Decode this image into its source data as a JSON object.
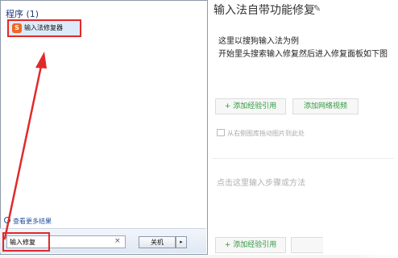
{
  "editor": {
    "title": "输入法自带功能修复",
    "edit_icon": "pencil-icon",
    "step1_lines": [
      "这里以搜狗输入法为例",
      "开始里头搜索输入修复然后进入修复面板如下图"
    ],
    "add_experience_label": "+ 添加经验引用",
    "add_video_label": "添加网络视频",
    "drag_hint": "从右侧图库拖动图片到此处",
    "step_placeholder": "点击这里输入步骤或方法",
    "add_experience_label_2": "+ 添加经验引用"
  },
  "start_menu": {
    "programs_header": "程序 (1)",
    "result_item": {
      "icon": "sogou-repair-app-icon",
      "icon_glyph": "S",
      "label": "输入法修复器"
    },
    "see_more": "查看更多结果",
    "search": {
      "value": "输入修复"
    },
    "clear_icon": "×",
    "shutdown_label": "关机",
    "shutdown_arrow": "▸"
  },
  "annotation": {
    "color": "#e02a2a"
  },
  "colors": {
    "highlight": "#e02a2a",
    "link": "#1f4f9b",
    "green_button_text": "#2e9a3e"
  }
}
